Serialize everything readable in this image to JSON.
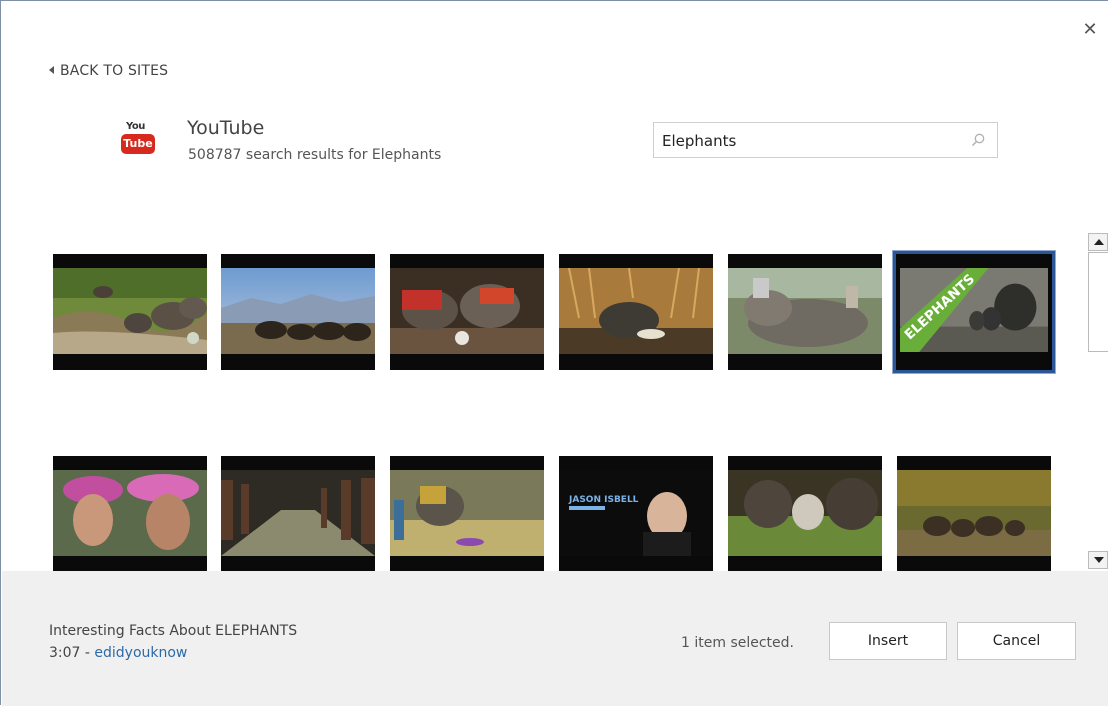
{
  "dialog": {
    "close_glyph": "✕",
    "back_label": "BACK TO SITES"
  },
  "site": {
    "logo_top": "You",
    "logo_bottom": "Tube",
    "name": "YouTube",
    "results_text": "508787 search results for Elephants"
  },
  "search": {
    "value": "Elephants",
    "placeholder": ""
  },
  "results": [
    {
      "id": "thumb-1",
      "scene": "elephants-river-green-bank",
      "selected": false
    },
    {
      "id": "thumb-2",
      "scene": "elephants-blue-sky-mountains",
      "selected": false
    },
    {
      "id": "thumb-3",
      "scene": "baby-elephants-red-blankets",
      "selected": false
    },
    {
      "id": "thumb-4",
      "scene": "elephant-in-golden-grass",
      "selected": false
    },
    {
      "id": "thumb-5",
      "scene": "elephant-bathing",
      "selected": false
    },
    {
      "id": "thumb-6",
      "scene": "elephants-title-card",
      "selected": true,
      "overlay_text": "ELEPHANTS"
    },
    {
      "id": "thumb-7",
      "scene": "woman-with-flower-crown",
      "selected": false
    },
    {
      "id": "thumb-8",
      "scene": "empty-elephant-stable",
      "selected": false
    },
    {
      "id": "thumb-9",
      "scene": "elephant-show-arena",
      "selected": false
    },
    {
      "id": "thumb-10",
      "scene": "man-portrait-poster",
      "selected": false,
      "overlay_text": "JASON ISBELL"
    },
    {
      "id": "thumb-11",
      "scene": "baby-elephant-herd",
      "selected": false
    },
    {
      "id": "thumb-12",
      "scene": "elephants-in-distance",
      "selected": false
    }
  ],
  "footer": {
    "selected_title": "Interesting Facts About ELEPHANTS",
    "selected_duration": "3:07 - ",
    "selected_channel": "edidyouknow",
    "selection_count": "1 item selected.",
    "insert_label": "Insert",
    "cancel_label": "Cancel"
  },
  "colors": {
    "selection_border": "#2b5797",
    "youtube_red": "#d62a1e",
    "link": "#2c6aa8",
    "footer_bg": "#f0f0f0"
  }
}
